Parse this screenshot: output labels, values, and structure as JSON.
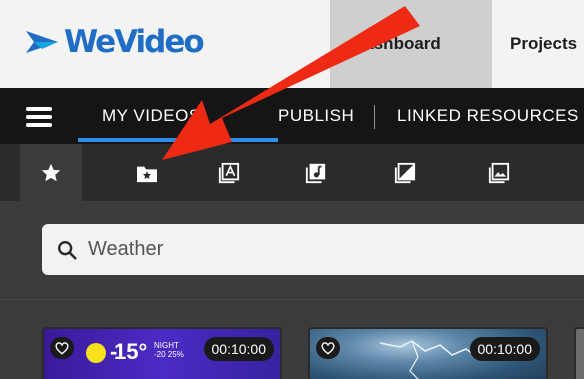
{
  "header": {
    "logo_text": "WeVideo",
    "nav": {
      "dashboard": "Dashboard",
      "projects": "Projects"
    }
  },
  "tabs": {
    "my_videos": "MY VIDEOS",
    "publish": "PUBLISH",
    "linked_resources": "LINKED RESOURCES"
  },
  "media_types": [
    {
      "icon": "star-icon",
      "label": "Favorites",
      "active": true
    },
    {
      "icon": "folder-star-icon",
      "label": "Starred folders",
      "active": false
    },
    {
      "icon": "text-icon",
      "label": "Text",
      "active": false
    },
    {
      "icon": "music-icon",
      "label": "Audio",
      "active": false
    },
    {
      "icon": "transition-icon",
      "label": "Transitions",
      "active": false
    },
    {
      "icon": "image-icon",
      "label": "Images",
      "active": false
    }
  ],
  "search": {
    "value": "Weather",
    "placeholder": "Search"
  },
  "thumbnails": [
    {
      "duration": "00:10:00",
      "temperature": "15°",
      "night_label": "NIGHT",
      "night_low": "-20",
      "night_pct": "25%"
    },
    {
      "duration": "00:10:00"
    }
  ],
  "colors": {
    "brand_blue": "#1f6dc4",
    "accent_underline": "#2f8ee8",
    "annotation_arrow": "#ee2a14"
  }
}
